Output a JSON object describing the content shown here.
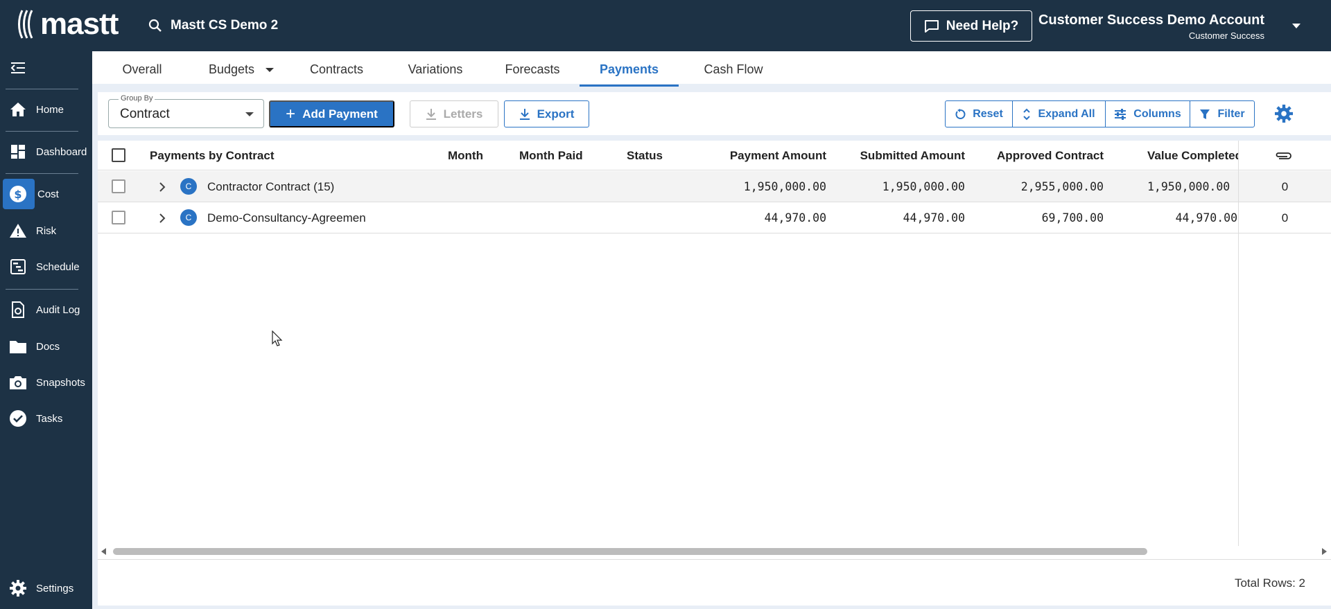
{
  "app": {
    "logo_text": "mastt",
    "project_name": "Mastt CS Demo 2"
  },
  "header": {
    "help_label": "Need Help?",
    "account_name": "Customer Success Demo Account",
    "account_role": "Customer Success"
  },
  "sidebar": {
    "items": [
      {
        "label": "Home",
        "icon": "home-icon"
      },
      {
        "label": "Dashboard",
        "icon": "dashboard-icon"
      },
      {
        "label": "Cost",
        "icon": "dollar-icon",
        "active": true
      },
      {
        "label": "Risk",
        "icon": "warning-icon"
      },
      {
        "label": "Schedule",
        "icon": "schedule-icon"
      },
      {
        "label": "Audit Log",
        "icon": "audit-icon"
      },
      {
        "label": "Docs",
        "icon": "folder-icon"
      },
      {
        "label": "Snapshots",
        "icon": "camera-icon"
      },
      {
        "label": "Tasks",
        "icon": "check-circle-icon"
      }
    ],
    "settings_label": "Settings"
  },
  "tabs": [
    {
      "label": "Overall"
    },
    {
      "label": "Budgets"
    },
    {
      "label": "Contracts"
    },
    {
      "label": "Variations"
    },
    {
      "label": "Forecasts"
    },
    {
      "label": "Payments",
      "active": true
    },
    {
      "label": "Cash Flow"
    }
  ],
  "toolbar": {
    "group_by_label": "Group By",
    "group_by_value": "Contract",
    "add_payment_label": "Add Payment",
    "letters_label": "Letters",
    "export_label": "Export",
    "reset_label": "Reset",
    "expand_all_label": "Expand All",
    "columns_label": "Columns",
    "filter_label": "Filter"
  },
  "table": {
    "columns": {
      "group": "Payments by Contract",
      "month": "Month",
      "month_paid": "Month Paid",
      "status": "Status",
      "payment_amount": "Payment Amount",
      "submitted_amount": "Submitted Amount",
      "approved_contract": "Approved Contract",
      "value_completed": "Value Completed"
    },
    "rows": [
      {
        "badge": "C",
        "name": "Contractor Contract",
        "count": "(15)",
        "payment_amount": "1,950,000.00",
        "submitted_amount": "1,950,000.00",
        "approved_contract": "2,955,000.00",
        "value_completed": "1,950,000.00",
        "attachments": "0"
      },
      {
        "badge": "C",
        "name": "Demo-Consultancy-Agreement",
        "count": "",
        "payment_amount": "44,970.00",
        "submitted_amount": "44,970.00",
        "approved_contract": "69,700.00",
        "value_completed": "44,970.00",
        "attachments": "0"
      }
    ],
    "total_rows_label": "Total Rows: 2"
  },
  "colors": {
    "navy": "#1d3245",
    "accent": "#2a73c4"
  }
}
